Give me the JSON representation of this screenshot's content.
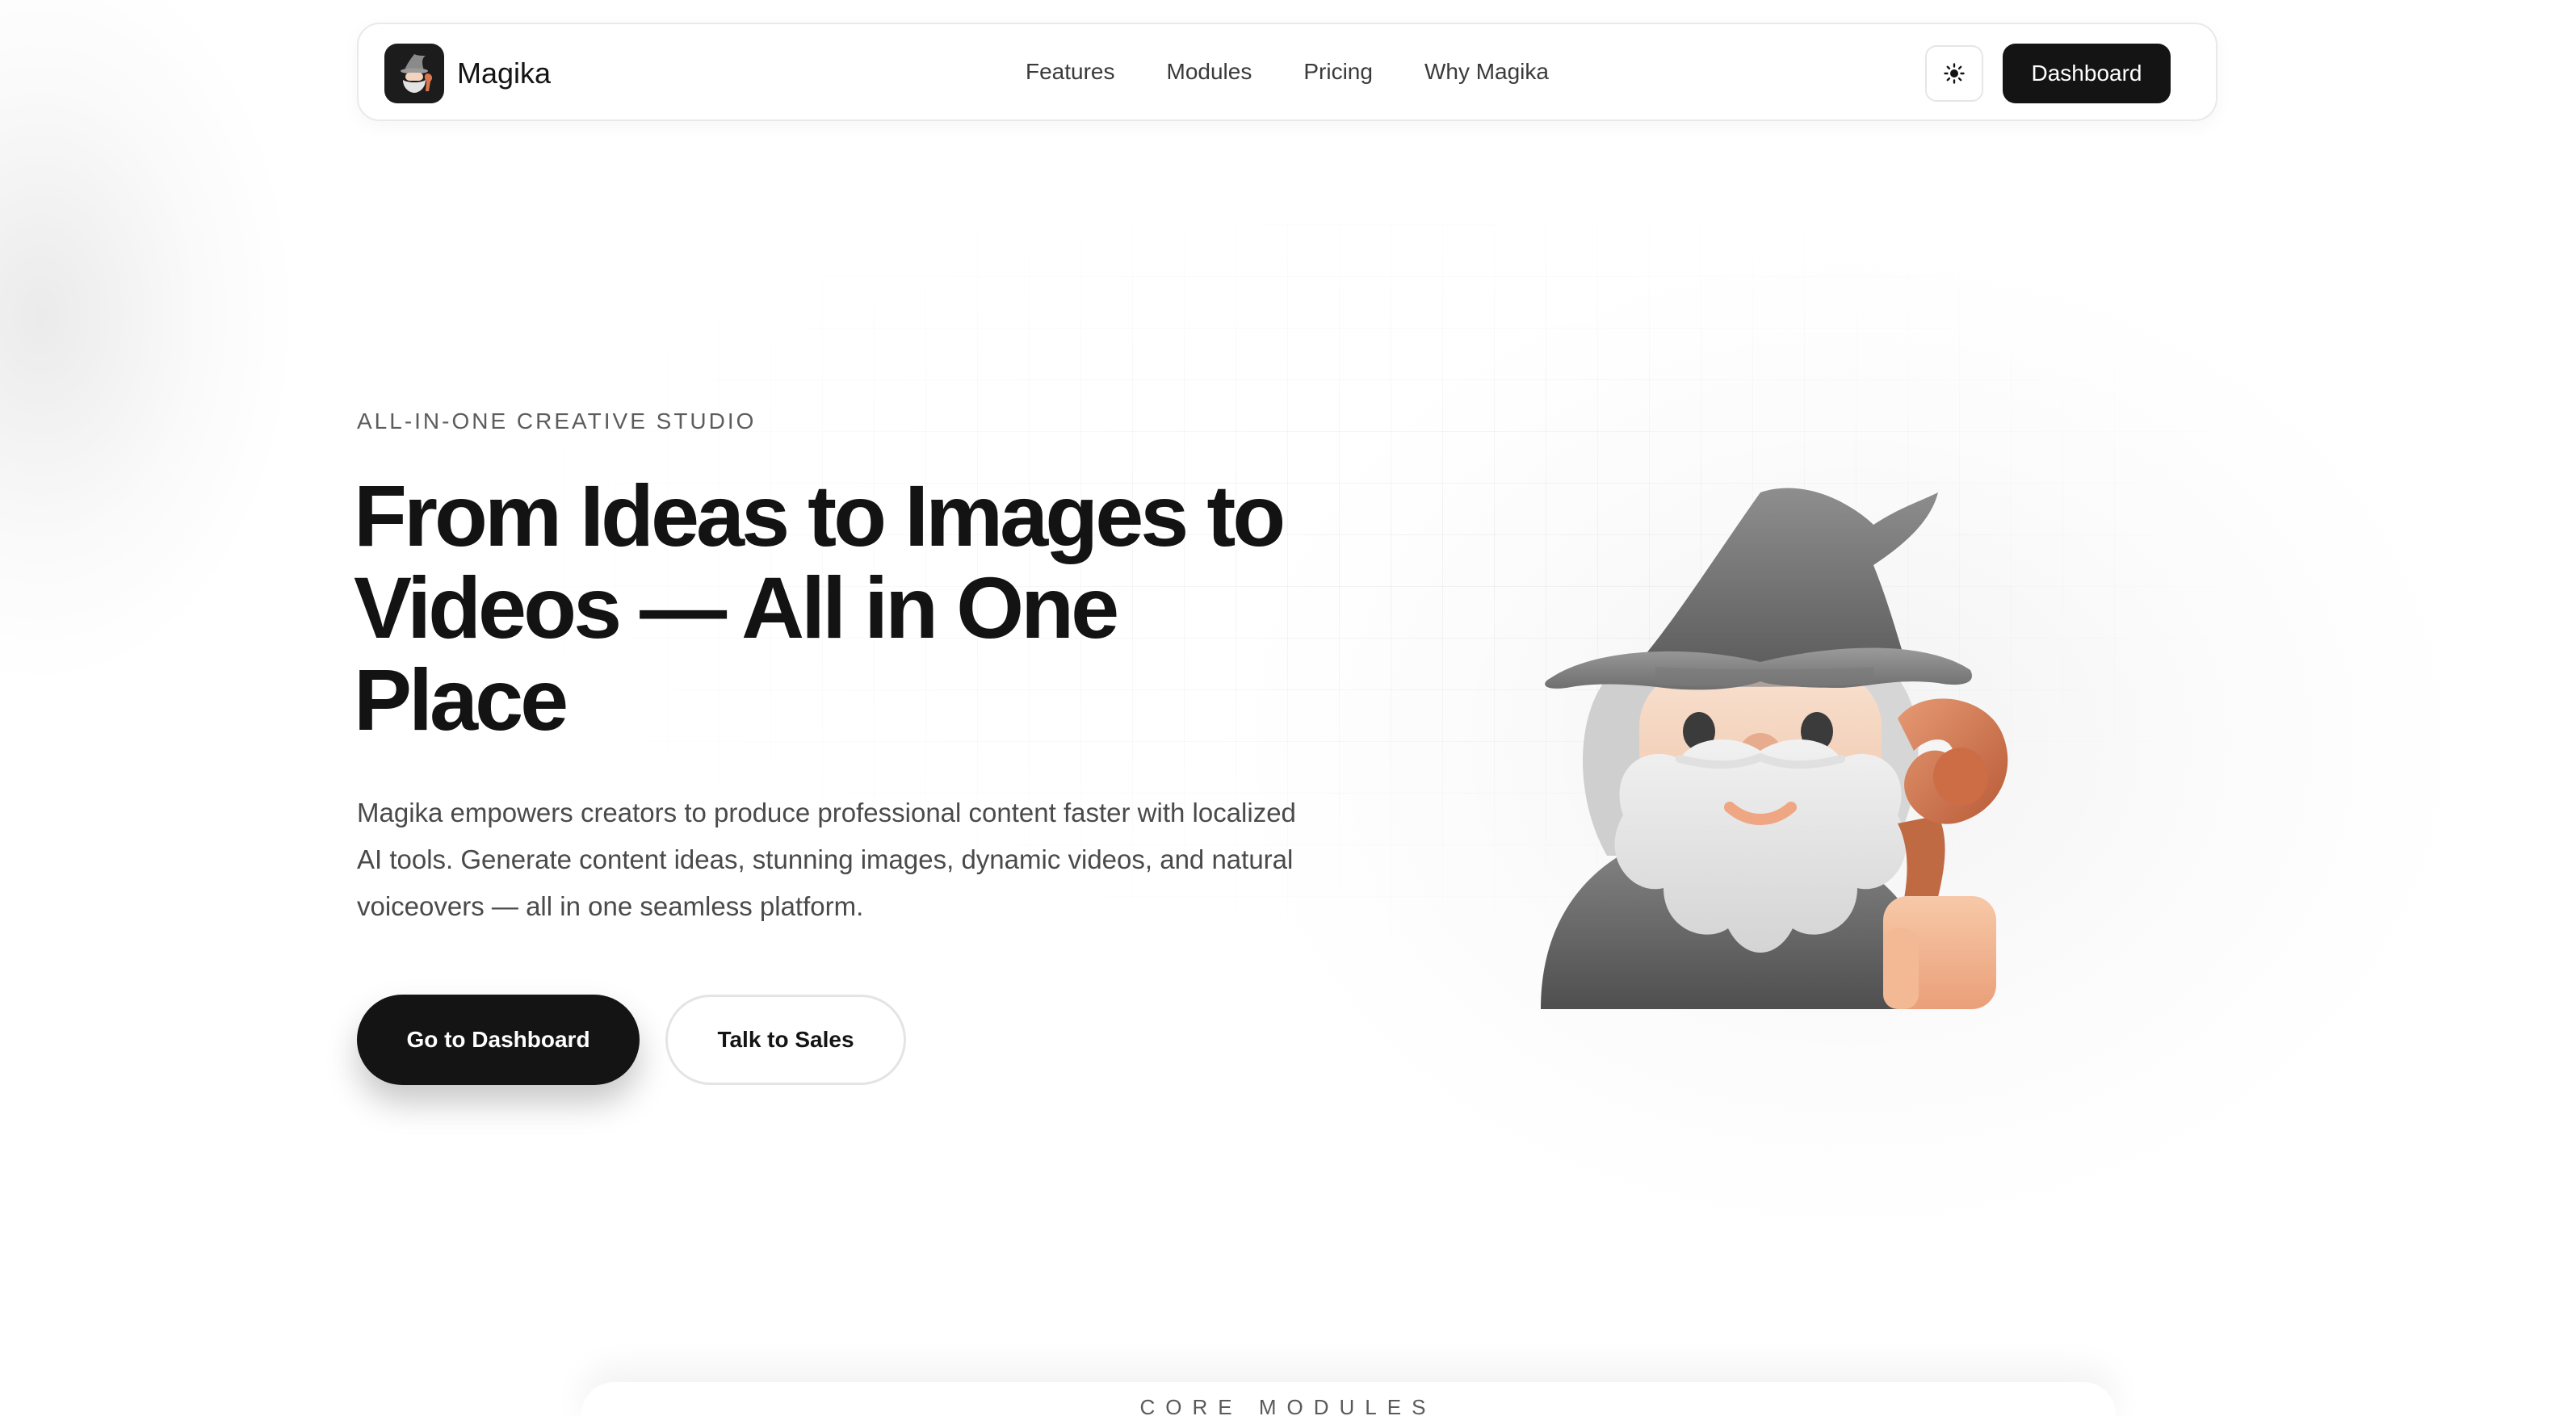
{
  "brand": {
    "name": "Magika",
    "logo_icon": "wizard-logo-icon"
  },
  "nav": {
    "links": [
      "Features",
      "Modules",
      "Pricing",
      "Why Magika"
    ],
    "theme_icon": "sun-icon",
    "dashboard_label": "Dashboard"
  },
  "hero": {
    "eyebrow": "ALL-IN-ONE CREATIVE STUDIO",
    "title": "From Ideas to Images to Videos — All in One Place",
    "description": "Magika empowers creators to produce professional content faster with localized AI tools. Generate content ideas, stunning images, dynamic videos, and natural voiceovers — all in one seamless platform.",
    "primary_cta": "Go to Dashboard",
    "secondary_cta": "Talk to Sales",
    "illustration": "wizard-illustration"
  },
  "section": {
    "label": "CORE MODULES"
  },
  "colors": {
    "primary": "#141414",
    "background": "#ffffff",
    "text_muted": "#4a4a4a",
    "accent_staff": "#d9774f"
  }
}
